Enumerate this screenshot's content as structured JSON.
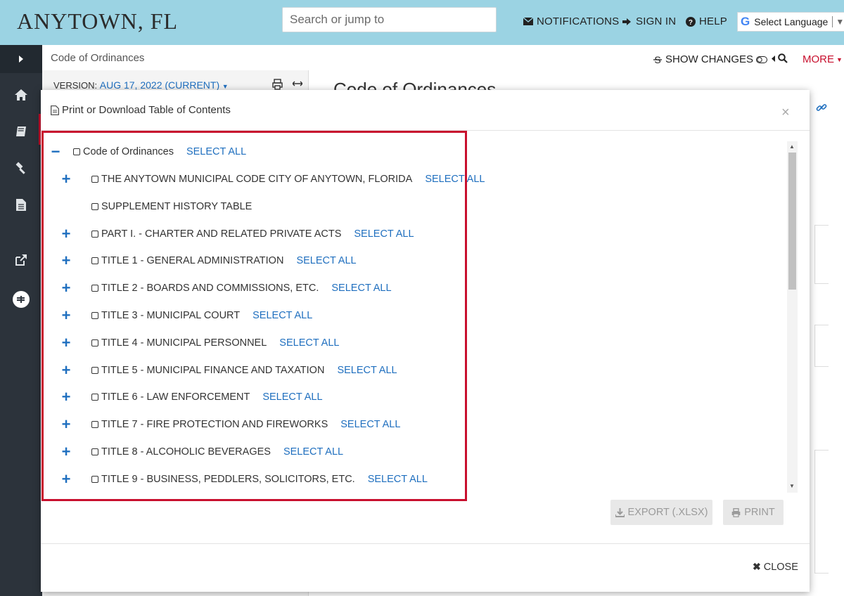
{
  "header": {
    "brand": "ANYTOWN, FL",
    "search_placeholder": "Search or jump to",
    "notifications": "NOTIFICATIONS",
    "sign_in": "SIGN IN",
    "help": "HELP",
    "language": "Select Language"
  },
  "page": {
    "breadcrumb": "Code of Ordinances",
    "show_changes": "SHOW CHANGES",
    "more": "MORE",
    "version_label": "VERSION:",
    "version_value": "AUG 17, 2022 (CURRENT)",
    "title": "Code of Ordinances"
  },
  "modal": {
    "title": "Print or Download Table of Contents",
    "close_x": "×",
    "root": {
      "label": "Code of Ordinances",
      "select_all": "SELECT ALL"
    },
    "items": [
      {
        "label": "THE ANYTOWN MUNICIPAL CODE CITY OF ANYTOWN, FLORIDA",
        "select_all": "SELECT ALL",
        "expandable": true
      },
      {
        "label": "SUPPLEMENT HISTORY TABLE",
        "select_all": "",
        "expandable": false
      },
      {
        "label": "PART I. - CHARTER AND RELATED PRIVATE ACTS",
        "select_all": "SELECT ALL",
        "expandable": true
      },
      {
        "label": "TITLE 1 - GENERAL ADMINISTRATION",
        "select_all": "SELECT ALL",
        "expandable": true
      },
      {
        "label": "TITLE 2 - BOARDS AND COMMISSIONS, ETC.",
        "select_all": "SELECT ALL",
        "expandable": true
      },
      {
        "label": "TITLE 3 - MUNICIPAL COURT",
        "select_all": "SELECT ALL",
        "expandable": true
      },
      {
        "label": "TITLE 4 - MUNICIPAL PERSONNEL",
        "select_all": "SELECT ALL",
        "expandable": true
      },
      {
        "label": "TITLE 5 - MUNICIPAL FINANCE AND TAXATION",
        "select_all": "SELECT ALL",
        "expandable": true
      },
      {
        "label": "TITLE 6 - LAW ENFORCEMENT",
        "select_all": "SELECT ALL",
        "expandable": true
      },
      {
        "label": "TITLE 7 - FIRE PROTECTION AND FIREWORKS",
        "select_all": "SELECT ALL",
        "expandable": true
      },
      {
        "label": "TITLE 8 - ALCOHOLIC BEVERAGES",
        "select_all": "SELECT ALL",
        "expandable": true
      },
      {
        "label": "TITLE 9 - BUSINESS, PEDDLERS, SOLICITORS, ETC.",
        "select_all": "SELECT ALL",
        "expandable": true
      }
    ],
    "export_label": "EXPORT (.XLSX)",
    "print_label": "PRINT",
    "close_label": "CLOSE"
  },
  "colors": {
    "header_bg": "#9bd3e3",
    "rail_bg": "#2c333b",
    "link_blue": "#1f6fbf",
    "highlight_red": "#c8102e"
  }
}
